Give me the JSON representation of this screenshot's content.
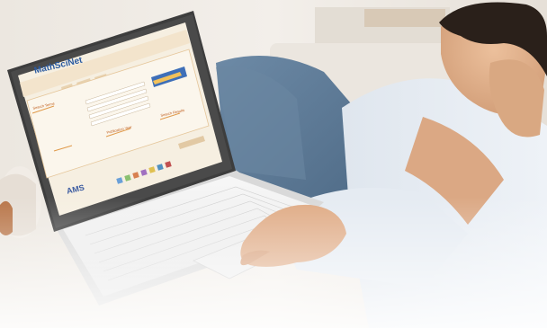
{
  "screen": {
    "site_name": "MathSciNet",
    "publisher": "AMS",
    "labels": {
      "search_terms": "Search Terms",
      "publication_year": "Publication Year",
      "search_results": "Search Results"
    }
  },
  "colors": {
    "wall": "#f2eee9",
    "laptop_bezel": "#404040",
    "screen_bg": "#f6efe1",
    "accent_orange": "#e0a050",
    "brand_blue": "#2a5aa0",
    "jeans": "#5c7a96",
    "shirt": "#e8eef5",
    "skin": "#e0b08c",
    "hair": "#2a201a"
  }
}
